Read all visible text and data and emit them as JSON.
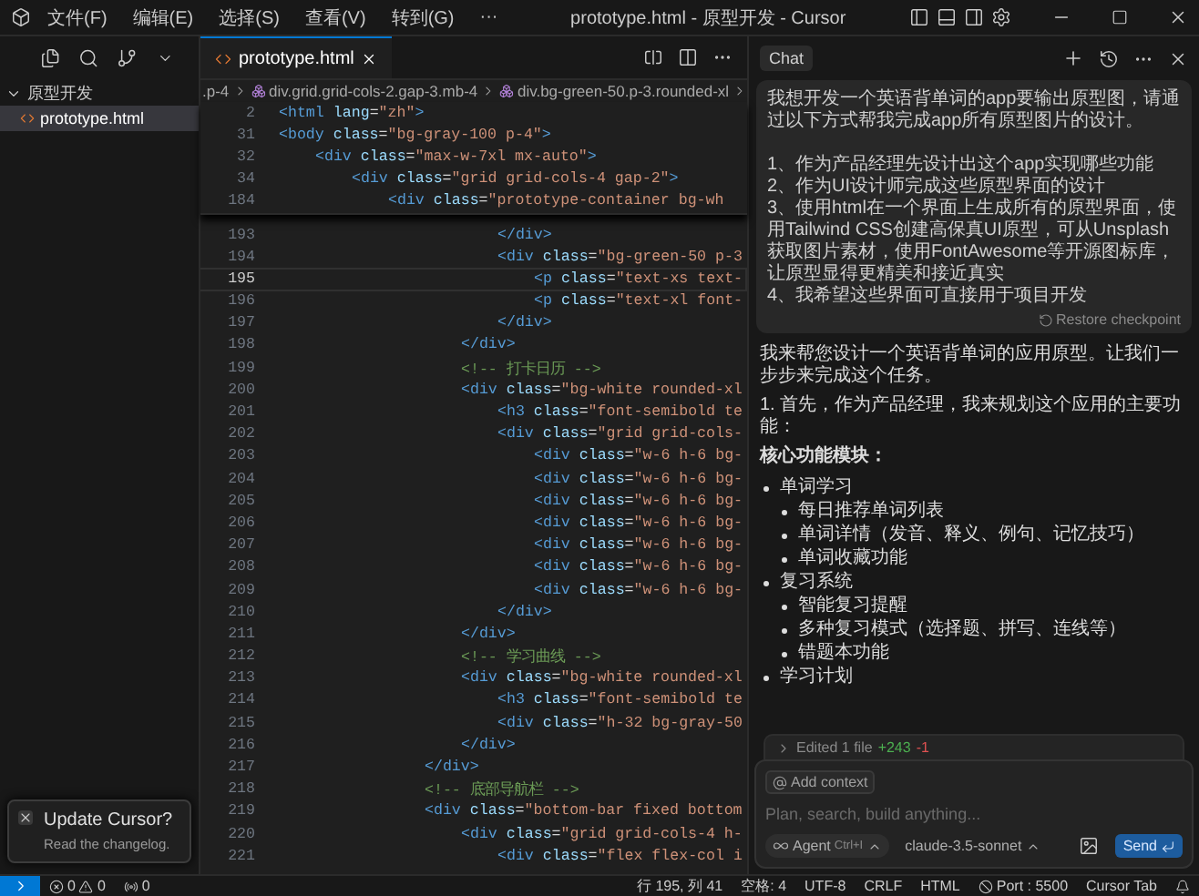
{
  "title_bar": {
    "menus": [
      "文件(F)",
      "编辑(E)",
      "选择(S)",
      "查看(V)",
      "转到(G)"
    ],
    "more": "···",
    "title": "prototype.html - 原型开发 - Cursor"
  },
  "explorer": {
    "folder": {
      "name": "原型开发",
      "expanded": true,
      "children": [
        {
          "name": "prototype.html",
          "selected": true
        }
      ]
    }
  },
  "notification": {
    "title": "Update Cursor?",
    "message": "Read the changelog."
  },
  "editor": {
    "tabs": [
      {
        "label": "prototype.html",
        "selected": true
      }
    ],
    "breadcrumb": [
      ".p-4",
      "div.grid.grid-cols-2.gap-3.mb-4",
      "div.bg-green-50.p-3.rounded-xl"
    ],
    "sticky_lines": [
      {
        "number": "2",
        "parts": [
          {
            "kind": "tag",
            "text": "<html"
          },
          {
            "kind": "attr",
            "text": " lang"
          },
          {
            "kind": "punct",
            "text": "="
          },
          {
            "kind": "str",
            "text": "\"zh\""
          },
          {
            "kind": "tag",
            "text": ">"
          }
        ]
      },
      {
        "number": "31",
        "parts": [
          {
            "kind": "tag",
            "text": "<body"
          },
          {
            "kind": "attr",
            "text": " class"
          },
          {
            "kind": "punct",
            "text": "="
          },
          {
            "kind": "str",
            "text": "\"bg-gray-100 p-4\""
          },
          {
            "kind": "tag",
            "text": ">"
          }
        ]
      },
      {
        "number": "32",
        "parts": [
          {
            "kind": "tag",
            "text": "    <div"
          },
          {
            "kind": "attr",
            "text": " class"
          },
          {
            "kind": "punct",
            "text": "="
          },
          {
            "kind": "str",
            "text": "\"max-w-7xl mx-auto\""
          },
          {
            "kind": "tag",
            "text": ">"
          }
        ]
      },
      {
        "number": "34",
        "parts": [
          {
            "kind": "tag",
            "text": "        <div"
          },
          {
            "kind": "attr",
            "text": " class"
          },
          {
            "kind": "punct",
            "text": "="
          },
          {
            "kind": "str",
            "text": "\"grid grid-cols-4 gap-2\""
          },
          {
            "kind": "tag",
            "text": ">"
          }
        ]
      },
      {
        "number": "184",
        "parts": [
          {
            "kind": "tag",
            "text": "            <div"
          },
          {
            "kind": "attr",
            "text": " class"
          },
          {
            "kind": "punct",
            "text": "="
          },
          {
            "kind": "str",
            "text": "\"prototype-container bg-wh"
          }
        ]
      }
    ],
    "lines": [
      {
        "number": "193",
        "current": false,
        "parts": [
          {
            "kind": "tag",
            "text": "                        </div>"
          }
        ]
      },
      {
        "number": "194",
        "current": false,
        "parts": [
          {
            "kind": "tag",
            "text": "                        <div"
          },
          {
            "kind": "attr",
            "text": " class"
          },
          {
            "kind": "punct",
            "text": "="
          },
          {
            "kind": "str",
            "text": "\"bg-green-50 p-3"
          }
        ]
      },
      {
        "number": "195",
        "current": true,
        "parts": [
          {
            "kind": "tag",
            "text": "                            <p"
          },
          {
            "kind": "attr",
            "text": " class"
          },
          {
            "kind": "punct",
            "text": "="
          },
          {
            "kind": "str",
            "text": "\"text-xs text-"
          }
        ]
      },
      {
        "number": "196",
        "current": false,
        "parts": [
          {
            "kind": "tag",
            "text": "                            <p"
          },
          {
            "kind": "attr",
            "text": " class"
          },
          {
            "kind": "punct",
            "text": "="
          },
          {
            "kind": "str",
            "text": "\"text-xl font-"
          }
        ]
      },
      {
        "number": "197",
        "current": false,
        "parts": [
          {
            "kind": "tag",
            "text": "                        </div>"
          }
        ]
      },
      {
        "number": "198",
        "current": false,
        "parts": [
          {
            "kind": "tag",
            "text": "                    </div>"
          }
        ]
      },
      {
        "number": "199",
        "current": false,
        "parts": [
          {
            "kind": "com",
            "text": "                    <!-- 打卡日历 -->"
          }
        ]
      },
      {
        "number": "200",
        "current": false,
        "parts": [
          {
            "kind": "tag",
            "text": "                    <div"
          },
          {
            "kind": "attr",
            "text": " class"
          },
          {
            "kind": "punct",
            "text": "="
          },
          {
            "kind": "str",
            "text": "\"bg-white rounded-xl"
          }
        ]
      },
      {
        "number": "201",
        "current": false,
        "parts": [
          {
            "kind": "tag",
            "text": "                        <h3"
          },
          {
            "kind": "attr",
            "text": " class"
          },
          {
            "kind": "punct",
            "text": "="
          },
          {
            "kind": "str",
            "text": "\"font-semibold te"
          }
        ]
      },
      {
        "number": "202",
        "current": false,
        "parts": [
          {
            "kind": "tag",
            "text": "                        <div"
          },
          {
            "kind": "attr",
            "text": " class"
          },
          {
            "kind": "punct",
            "text": "="
          },
          {
            "kind": "str",
            "text": "\"grid grid-cols-"
          }
        ]
      },
      {
        "number": "203",
        "current": false,
        "parts": [
          {
            "kind": "tag",
            "text": "                            <div"
          },
          {
            "kind": "attr",
            "text": " class"
          },
          {
            "kind": "punct",
            "text": "="
          },
          {
            "kind": "str",
            "text": "\"w-6 h-6 bg-"
          }
        ]
      },
      {
        "number": "204",
        "current": false,
        "parts": [
          {
            "kind": "tag",
            "text": "                            <div"
          },
          {
            "kind": "attr",
            "text": " class"
          },
          {
            "kind": "punct",
            "text": "="
          },
          {
            "kind": "str",
            "text": "\"w-6 h-6 bg-"
          }
        ]
      },
      {
        "number": "205",
        "current": false,
        "parts": [
          {
            "kind": "tag",
            "text": "                            <div"
          },
          {
            "kind": "attr",
            "text": " class"
          },
          {
            "kind": "punct",
            "text": "="
          },
          {
            "kind": "str",
            "text": "\"w-6 h-6 bg-"
          }
        ]
      },
      {
        "number": "206",
        "current": false,
        "parts": [
          {
            "kind": "tag",
            "text": "                            <div"
          },
          {
            "kind": "attr",
            "text": " class"
          },
          {
            "kind": "punct",
            "text": "="
          },
          {
            "kind": "str",
            "text": "\"w-6 h-6 bg-"
          }
        ]
      },
      {
        "number": "207",
        "current": false,
        "parts": [
          {
            "kind": "tag",
            "text": "                            <div"
          },
          {
            "kind": "attr",
            "text": " class"
          },
          {
            "kind": "punct",
            "text": "="
          },
          {
            "kind": "str",
            "text": "\"w-6 h-6 bg-"
          }
        ]
      },
      {
        "number": "208",
        "current": false,
        "parts": [
          {
            "kind": "tag",
            "text": "                            <div"
          },
          {
            "kind": "attr",
            "text": " class"
          },
          {
            "kind": "punct",
            "text": "="
          },
          {
            "kind": "str",
            "text": "\"w-6 h-6 bg-"
          }
        ]
      },
      {
        "number": "209",
        "current": false,
        "parts": [
          {
            "kind": "tag",
            "text": "                            <div"
          },
          {
            "kind": "attr",
            "text": " class"
          },
          {
            "kind": "punct",
            "text": "="
          },
          {
            "kind": "str",
            "text": "\"w-6 h-6 bg-"
          }
        ]
      },
      {
        "number": "210",
        "current": false,
        "parts": [
          {
            "kind": "tag",
            "text": "                        </div>"
          }
        ]
      },
      {
        "number": "211",
        "current": false,
        "parts": [
          {
            "kind": "tag",
            "text": "                    </div>"
          }
        ]
      },
      {
        "number": "212",
        "current": false,
        "parts": [
          {
            "kind": "com",
            "text": "                    <!-- 学习曲线 -->"
          }
        ]
      },
      {
        "number": "213",
        "current": false,
        "parts": [
          {
            "kind": "tag",
            "text": "                    <div"
          },
          {
            "kind": "attr",
            "text": " class"
          },
          {
            "kind": "punct",
            "text": "="
          },
          {
            "kind": "str",
            "text": "\"bg-white rounded-xl"
          }
        ]
      },
      {
        "number": "214",
        "current": false,
        "parts": [
          {
            "kind": "tag",
            "text": "                        <h3"
          },
          {
            "kind": "attr",
            "text": " class"
          },
          {
            "kind": "punct",
            "text": "="
          },
          {
            "kind": "str",
            "text": "\"font-semibold te"
          }
        ]
      },
      {
        "number": "215",
        "current": false,
        "parts": [
          {
            "kind": "tag",
            "text": "                        <div"
          },
          {
            "kind": "attr",
            "text": " class"
          },
          {
            "kind": "punct",
            "text": "="
          },
          {
            "kind": "str",
            "text": "\"h-32 bg-gray-50"
          }
        ]
      },
      {
        "number": "216",
        "current": false,
        "parts": [
          {
            "kind": "tag",
            "text": "                    </div>"
          }
        ]
      },
      {
        "number": "217",
        "current": false,
        "parts": [
          {
            "kind": "tag",
            "text": "                </div>"
          }
        ]
      },
      {
        "number": "218",
        "current": false,
        "parts": [
          {
            "kind": "com",
            "text": "                <!-- 底部导航栏 -->"
          }
        ]
      },
      {
        "number": "219",
        "current": false,
        "parts": [
          {
            "kind": "tag",
            "text": "                <div"
          },
          {
            "kind": "attr",
            "text": " class"
          },
          {
            "kind": "punct",
            "text": "="
          },
          {
            "kind": "str",
            "text": "\"bottom-bar fixed bottom"
          }
        ]
      },
      {
        "number": "220",
        "current": false,
        "parts": [
          {
            "kind": "tag",
            "text": "                    <div"
          },
          {
            "kind": "attr",
            "text": " class"
          },
          {
            "kind": "punct",
            "text": "="
          },
          {
            "kind": "str",
            "text": "\"grid grid-cols-4 h-"
          }
        ]
      },
      {
        "number": "221",
        "current": false,
        "parts": [
          {
            "kind": "tag",
            "text": "                        <div"
          },
          {
            "kind": "attr",
            "text": " class"
          },
          {
            "kind": "punct",
            "text": "="
          },
          {
            "kind": "str",
            "text": "\"flex flex-col i"
          }
        ]
      }
    ]
  },
  "chat": {
    "tab": "Chat",
    "user_message": {
      "paragraphs": [
        "我想开发一个英语背单词的app要输出原型图，请通过以下方式帮我完成app所有原型图片的设计。",
        "1、作为产品经理先设计出这个app实现哪些功能",
        "2、作为UI设计师完成这些原型界面的设计",
        "3、使用html在一个界面上生成所有的原型界面，使用Tailwind CSS创建高保真UI原型，可从Unsplash获取图片素材，使用FontAwesome等开源图标库，让原型显得更精美和接近真实",
        "4、我希望这些界面可直接用于项目开发"
      ],
      "restore": "Restore checkpoint"
    },
    "response": {
      "intro": "我来帮您设计一个英语背单词的应用原型。让我们一步步来完成这个任务。",
      "step": "1. 首先，作为产品经理，我来规划这个应用的主要功能：",
      "heading": "核心功能模块：",
      "items": [
        {
          "text": "单词学习",
          "children": [
            {
              "text": "每日推荐单词列表"
            },
            {
              "text": "单词详情（发音、释义、例句、记忆技巧）"
            },
            {
              "text": "单词收藏功能"
            }
          ]
        },
        {
          "text": "复习系统",
          "children": [
            {
              "text": "智能复习提醒"
            },
            {
              "text": "多种复习模式（选择题、拼写、连线等）"
            },
            {
              "text": "错题本功能"
            }
          ]
        },
        {
          "text": "学习计划"
        }
      ]
    },
    "edits": {
      "label": "Edited 1 file",
      "added": "+243",
      "removed": "-1"
    },
    "composer": {
      "context": "Add context",
      "placeholder": "Plan, search, build anything...",
      "mode": "Agent",
      "shortcut": "Ctrl+I",
      "model": "claude-3.5-sonnet",
      "send": "Send"
    }
  },
  "status_bar": {
    "errors": "0",
    "warnings": "0",
    "ports": "0",
    "position": "行 195, 列 41",
    "indent": "空格: 4",
    "encoding": "UTF-8",
    "eol": "CRLF",
    "language": "HTML",
    "port": "Port : 5500",
    "cursor_tab": "Cursor Tab"
  }
}
